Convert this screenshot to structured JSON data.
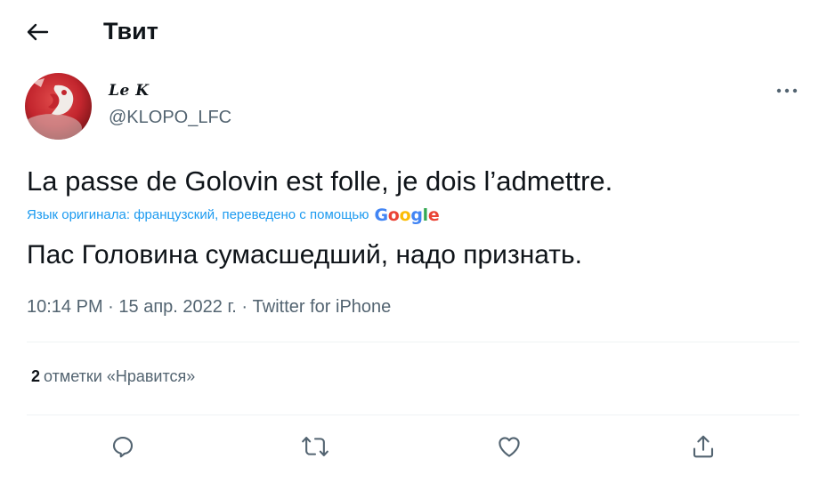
{
  "header": {
    "title": "Твит"
  },
  "tweet": {
    "author": {
      "display_name": "Le K",
      "handle": "@KLOPO_LFC"
    },
    "text": "La passe de Golovin est folle, je dois l’admettre.",
    "translation": {
      "note": "Язык оригинала: французский, переведено с помощью",
      "provider": "Google",
      "text": "Пас Головина сумасшедший, надо признать."
    },
    "meta": {
      "time": "10:14 PM",
      "separator": "·",
      "date": "15 апр. 2022 г.",
      "source": "Twitter for iPhone"
    },
    "likes": {
      "count": "2",
      "label": "отметки «Нравится»"
    }
  },
  "icons": {
    "back": "arrow-left-icon",
    "more": "more-horizontal-icon",
    "reply": "reply-icon",
    "retweet": "retweet-icon",
    "like": "heart-icon",
    "share": "share-icon"
  },
  "colors": {
    "text": "#0f1419",
    "secondary": "#536471",
    "link": "#1d9bf0",
    "divider": "#eff3f4",
    "google_blue": "#4285f4",
    "google_red": "#ea4335",
    "google_yellow": "#fbbc05",
    "google_green": "#34a853"
  }
}
